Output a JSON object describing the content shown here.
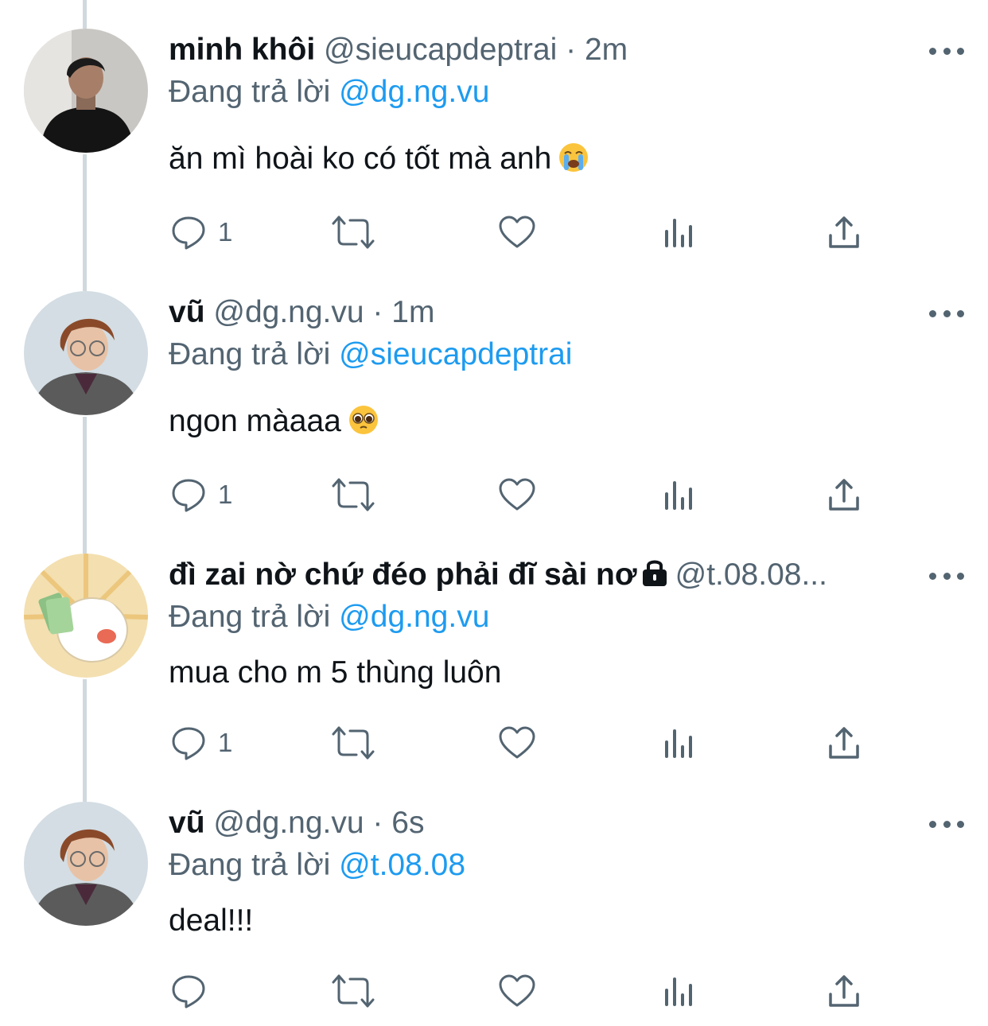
{
  "reply_prefix": "Đang trả lời",
  "colors": {
    "accent": "#1d9bf0",
    "secondary": "#536471",
    "thread_line": "#cfd9de"
  },
  "tweets": [
    {
      "name": "minh khôi",
      "handle": "@sieucapdeptrai",
      "separator": "·",
      "time": "2m",
      "replying_to": "@dg.ng.vu",
      "text": "ăn mì hoài ko có tốt mà anh",
      "emoji": "loudly-crying-face",
      "reply_count": "1",
      "avatar": "man-black-shirt-photo",
      "locked": false
    },
    {
      "name": "vũ",
      "handle": "@dg.ng.vu",
      "separator": "·",
      "time": "1m",
      "replying_to": "@sieucapdeptrai",
      "text": "ngon màaaa",
      "emoji": "pleading-face",
      "reply_count": "1",
      "avatar": "man-glasses-photo",
      "locked": false
    },
    {
      "name": "đì zai nờ chứ đéo phải đĩ sài nơ",
      "handle": "@t.08.08...",
      "separator": "",
      "time": "",
      "replying_to": "@dg.ng.vu",
      "text": "mua cho m 5 thùng luôn",
      "emoji": "",
      "reply_count": "1",
      "avatar": "cartoon-dog-holding-money",
      "locked": true
    },
    {
      "name": "vũ",
      "handle": "@dg.ng.vu",
      "separator": "·",
      "time": "6s",
      "replying_to": "@t.08.08",
      "text": "deal!!!",
      "emoji": "",
      "reply_count": "",
      "avatar": "man-glasses-photo",
      "locked": false
    }
  ]
}
